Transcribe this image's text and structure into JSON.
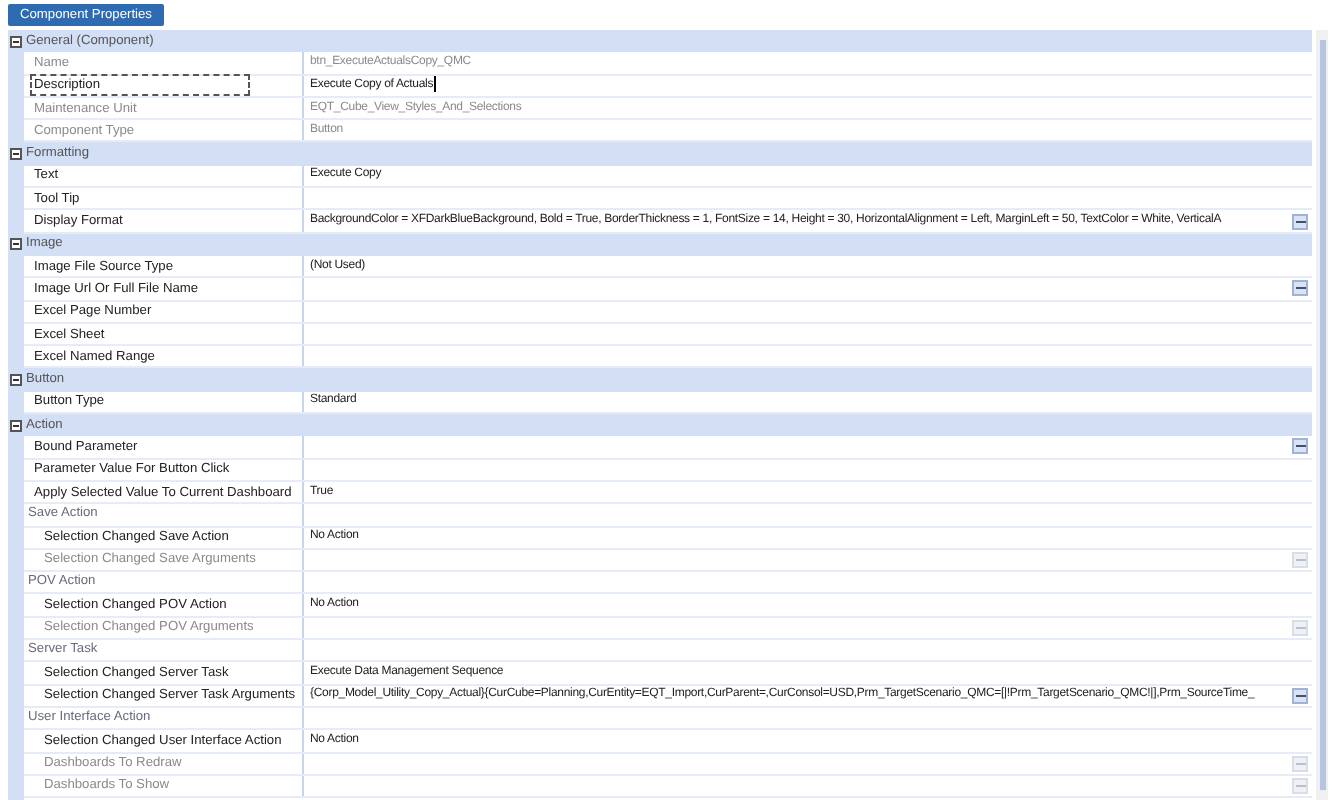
{
  "header_button": {
    "label": "Component Properties"
  },
  "sections": [
    {
      "title": "General (Component)",
      "expanded": true,
      "rows": [
        {
          "kind": "property",
          "name": "Name",
          "value": "btn_ExecuteActualsCopy_QMC",
          "disabled": true,
          "ellipsis": false,
          "focused": false
        },
        {
          "kind": "property",
          "name": "Description",
          "value": "Execute Copy of Actuals",
          "disabled": false,
          "ellipsis": false,
          "focused": true
        },
        {
          "kind": "property",
          "name": "Maintenance Unit",
          "value": "EQT_Cube_View_Styles_And_Selections",
          "disabled": true,
          "ellipsis": false,
          "focused": false
        },
        {
          "kind": "property",
          "name": "Component Type",
          "value": "Button",
          "disabled": true,
          "ellipsis": false,
          "focused": false
        }
      ]
    },
    {
      "title": "Formatting",
      "expanded": true,
      "rows": [
        {
          "kind": "property",
          "name": "Text",
          "value": "Execute Copy",
          "disabled": false,
          "ellipsis": false,
          "focused": false
        },
        {
          "kind": "property",
          "name": "Tool Tip",
          "disabled": false,
          "ellipsis": false,
          "focused": false
        },
        {
          "kind": "property",
          "name": "Display Format",
          "value": "BackgroundColor = XFDarkBlueBackground, Bold = True, BorderThickness = 1, FontSize = 14, Height = 30, HorizontalAlignment = Left, MarginLeft = 50, TextColor = White, VerticalA",
          "disabled": false,
          "ellipsis": true,
          "focused": false
        }
      ]
    },
    {
      "title": "Image",
      "expanded": true,
      "rows": [
        {
          "kind": "property",
          "name": "Image File Source Type",
          "value": "(Not Used)",
          "disabled": false,
          "ellipsis": false,
          "focused": false
        },
        {
          "kind": "property",
          "name": "Image Url Or Full File Name",
          "disabled": false,
          "ellipsis": true,
          "focused": false
        },
        {
          "kind": "property",
          "name": "Excel Page Number",
          "disabled": false,
          "ellipsis": false,
          "focused": false
        },
        {
          "kind": "property",
          "name": "Excel Sheet",
          "disabled": false,
          "ellipsis": false,
          "focused": false
        },
        {
          "kind": "property",
          "name": "Excel Named Range",
          "disabled": false,
          "ellipsis": false,
          "focused": false
        }
      ]
    },
    {
      "title": "Button",
      "expanded": true,
      "rows": [
        {
          "kind": "property",
          "name": "Button Type",
          "value": "Standard",
          "disabled": false,
          "ellipsis": false,
          "focused": false
        }
      ]
    },
    {
      "title": "Action",
      "expanded": true,
      "rows": [
        {
          "kind": "property",
          "name": "Bound Parameter",
          "disabled": false,
          "ellipsis": true,
          "focused": false
        },
        {
          "kind": "property",
          "name": "Parameter Value For Button Click",
          "disabled": false,
          "ellipsis": false,
          "focused": false
        },
        {
          "kind": "property",
          "name": "Apply Selected Value To Current Dashboard",
          "value": "True",
          "disabled": false,
          "ellipsis": false,
          "focused": false
        },
        {
          "kind": "group",
          "name": "Save Action",
          "children": [
            {
              "kind": "property",
              "name": "Selection Changed Save Action",
              "value": "No Action",
              "disabled": false,
              "ellipsis": false,
              "focused": false
            },
            {
              "kind": "property",
              "name": "Selection Changed Save Arguments",
              "disabled": true,
              "ellipsis": true,
              "focused": false
            }
          ]
        },
        {
          "kind": "group",
          "name": "POV Action",
          "children": [
            {
              "kind": "property",
              "name": "Selection Changed POV Action",
              "value": "No Action",
              "disabled": false,
              "ellipsis": false,
              "focused": false
            },
            {
              "kind": "property",
              "name": "Selection Changed POV Arguments",
              "disabled": true,
              "ellipsis": true,
              "focused": false
            }
          ]
        },
        {
          "kind": "group",
          "name": "Server Task",
          "children": [
            {
              "kind": "property",
              "name": "Selection Changed Server Task",
              "value": "Execute Data Management Sequence",
              "disabled": false,
              "ellipsis": false,
              "focused": false
            },
            {
              "kind": "property",
              "name": "Selection Changed Server Task Arguments",
              "value": "{Corp_Model_Utility_Copy_Actual}{CurCube=Planning,CurEntity=EQT_Import,CurParent=,CurConsol=USD,Prm_TargetScenario_QMC=[|!Prm_TargetScenario_QMC!|],Prm_SourceTime_",
              "disabled": false,
              "ellipsis": true,
              "focused": false
            }
          ]
        },
        {
          "kind": "group",
          "name": "User Interface Action",
          "children": [
            {
              "kind": "property",
              "name": "Selection Changed User Interface Action",
              "value": "No Action",
              "disabled": false,
              "ellipsis": false,
              "focused": false
            },
            {
              "kind": "property",
              "name": "Dashboards To Redraw",
              "disabled": true,
              "ellipsis": true,
              "focused": false
            },
            {
              "kind": "property",
              "name": "Dashboards To Show",
              "disabled": true,
              "ellipsis": true,
              "focused": false
            }
          ]
        }
      ]
    }
  ]
}
